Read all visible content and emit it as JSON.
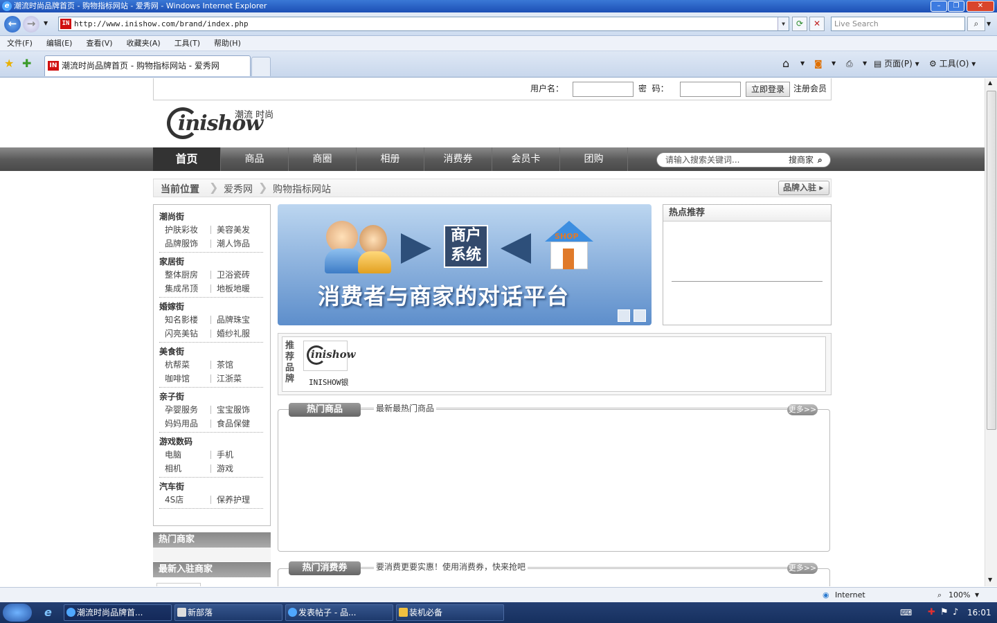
{
  "window": {
    "title": "潮流时尚品牌首页 - 购物指标网站 - 爱秀网 - Windows Internet Explorer"
  },
  "address": {
    "url": "http://www.inishow.com/brand/index.php",
    "favicon": "IN",
    "search_placeholder": "Live Search"
  },
  "menu": [
    "文件(F)",
    "编辑(E)",
    "查看(V)",
    "收藏夹(A)",
    "工具(T)",
    "帮助(H)"
  ],
  "tab": {
    "label": "潮流时尚品牌首页 - 购物指标网站 - 爱秀网"
  },
  "toolbar": {
    "page": "页面(P)",
    "tools": "工具(O)"
  },
  "login": {
    "username_label": "用户名：",
    "password_label": "密  码：",
    "login_button": "立即登录",
    "register": "注册会员"
  },
  "logo": {
    "text": "inishow",
    "tagline": "潮流 时尚"
  },
  "nav": {
    "items": [
      "首页",
      "商品",
      "商圈",
      "相册",
      "消费券",
      "会员卡",
      "团购"
    ],
    "search_placeholder": "请输入搜索关键词...",
    "search_button": "搜商家"
  },
  "breadcrumb": {
    "label": "当前位置",
    "items": [
      "爱秀网",
      "购物指标网站"
    ],
    "brand_button": "品牌入驻"
  },
  "categories": [
    {
      "title": "潮尚街",
      "items": [
        "护肤彩妆",
        "美容美发",
        "品牌服饰",
        "潮人饰品"
      ]
    },
    {
      "title": "家居街",
      "items": [
        "整体厨房",
        "卫浴瓷砖",
        "集成吊顶",
        "地板地暖"
      ]
    },
    {
      "title": "婚嫁街",
      "items": [
        "知名影楼",
        "品牌珠宝",
        "闪亮美钻",
        "婚纱礼服"
      ]
    },
    {
      "title": "美食街",
      "items": [
        "杭帮菜",
        "茶馆",
        "咖啡馆",
        "江浙菜"
      ]
    },
    {
      "title": "亲子街",
      "items": [
        "孕婴服务",
        "宝宝服饰",
        "妈妈用品",
        "食品保健"
      ]
    },
    {
      "title": "游戏数码",
      "items": [
        "电脑",
        "手机",
        "相机",
        "游戏"
      ]
    },
    {
      "title": "汽车街",
      "items": [
        "4S店",
        "保养护理"
      ]
    }
  ],
  "sidebar": {
    "hot_merchants": "热门商家",
    "new_merchants": "最新入驻商家"
  },
  "banner": {
    "system_line1": "商户",
    "system_line2": "系统",
    "shop": "SHOP",
    "slogan": "消费者与商家的对话平台"
  },
  "hot_recommend": {
    "title": "热点推荐"
  },
  "recommended_brands": {
    "label": "推荐品牌",
    "brand_name": "INISHOW银",
    "brand_logo_text": "inishow"
  },
  "hot_goods": {
    "tab": "热门商品",
    "subtitle": "最新最热门商品",
    "more": "更多>>"
  },
  "hot_coupons": {
    "tab": "热门消费券",
    "subtitle": "要消费更要实惠！使用消费券，快来抢吧",
    "more": "更多>>"
  },
  "status": {
    "zone": "Internet",
    "zoom": "100%"
  },
  "taskbar": {
    "tasks": [
      "潮流时尚品牌首...",
      "新部落",
      "发表帖子 - 品...",
      "装机必备"
    ],
    "clock": "16:01"
  }
}
